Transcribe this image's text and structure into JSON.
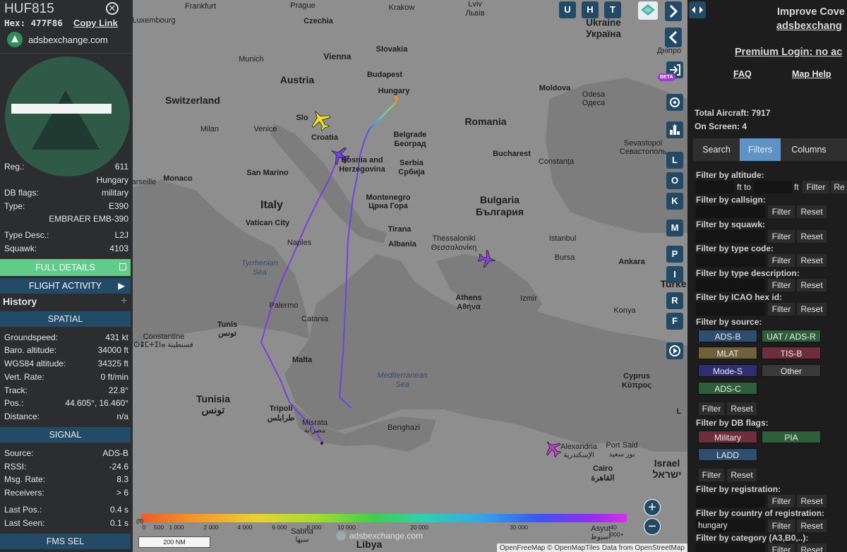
{
  "left": {
    "callsign": "HUF815",
    "hex_label": "Hex:",
    "hex": "477F86",
    "copy_link": "Copy Link",
    "brand": "adsbexchange.com",
    "fields": [
      {
        "key": "Reg.:",
        "value": "611"
      },
      {
        "key": "",
        "value": "Hungary"
      },
      {
        "key": "DB flags:",
        "value": "military"
      },
      {
        "key": "Type:",
        "value": "E390"
      },
      {
        "key": "",
        "value": "EMBRAER EMB-390"
      },
      {
        "key": "Type Desc.:",
        "value": "L2J"
      },
      {
        "key": "Squawk:",
        "value": "4103"
      }
    ],
    "full_details": "FULL DETAILS",
    "flight_activity": "FLIGHT ACTIVITY",
    "history": "History",
    "spatial_header": "SPATIAL",
    "spatial": [
      {
        "key": "Groundspeed:",
        "value": "431 kt"
      },
      {
        "key": "Baro. altitude:",
        "value": "34000 ft"
      },
      {
        "key": "WGS84 altitude:",
        "value": "34325 ft"
      },
      {
        "key": "Vert. Rate:",
        "value": "0 ft/min"
      },
      {
        "key": "Track:",
        "value": "22.8°"
      },
      {
        "key": "Pos.:",
        "value": "44.605°, 16.460°"
      },
      {
        "key": "Distance:",
        "value": "n/a"
      }
    ],
    "signal_header": "SIGNAL",
    "signal": [
      {
        "key": "Source:",
        "value": "ADS-B"
      },
      {
        "key": "RSSI:",
        "value": "-24.6"
      },
      {
        "key": "Msg. Rate:",
        "value": "8.3"
      },
      {
        "key": "Receivers:",
        "value": "> 6"
      },
      {
        "key": "Last Pos.:",
        "value": "0.4 s"
      },
      {
        "key": "Last Seen:",
        "value": "0.1 s"
      }
    ],
    "fms_header": "FMS SEL"
  },
  "map": {
    "labels": {
      "frankfurt": "Frankfurt",
      "prague": "Prague",
      "krakow": "Krakow",
      "lviv": "Lviv",
      "lviv_local": "Львів",
      "luxembourg": "Luxembourg",
      "czechia": "Czechia",
      "ukraine": "Ukraine",
      "ukraine_local": "Україна",
      "slovakia": "Slovakia",
      "munich": "Munich",
      "vienna": "Vienna",
      "dnipro": "Дніпро",
      "austria": "Austria",
      "budapest": "Budapest",
      "hungary": "Hungary",
      "moldova": "Moldova",
      "odesa": "Odesa",
      "odesa_local": "Одеса",
      "switzerland": "Switzerland",
      "milan": "Milan",
      "venice": "Venice",
      "slovenia": "Slo",
      "croatia": "Croatia",
      "belgrade": "Belgrade",
      "belgrade_local": "Београд",
      "serbia": "Serbia",
      "serbia_local": "Србија",
      "romania": "Romania",
      "bucharest": "Bucharest",
      "constanta": "Constanța",
      "sevastopol": "Sevastopol",
      "sevastopol_local": "Севастополь",
      "bosnia": "Bosnia and",
      "herzegovina": "Herzegovina",
      "monaco": "Monaco",
      "marseille": "arseille",
      "san_marino": "San Marino",
      "montenegro": "Montenegro",
      "montenegro_local": "Црна Гора",
      "bulgaria": "Bulgaria",
      "bulgaria_local": "България",
      "italy": "Italy",
      "vatican": "Vatican City",
      "tirana": "Tirana",
      "albania": "Albania",
      "thessaloniki": "Thessaloniki",
      "thessaloniki_local": "Θεσσαλονίκη",
      "istanbul": "Istanbul",
      "naples": "Naples",
      "tyrrhenian": "Tyrrhenian",
      "tyrrhenian2": "Sea",
      "bursa": "Bursa",
      "ankara": "Ankara",
      "athens": "Athens",
      "athens_local": "Αθήνα",
      "izmir": "Izmir",
      "turkey": "Turke",
      "palermo": "Palermo",
      "tunis": "Tunis",
      "tunis_local": "تونس",
      "catania": "Catania",
      "konya": "Konya",
      "constantine": "Constantine",
      "constantine_local": "ⵇⵙⴻⵎⵜⵉⵏⴰ قسنطينة",
      "malta": "Malta",
      "mediterranean": "Mediterranean",
      "mediterranean2": "Sea",
      "cyprus": "Cyprus",
      "cyprus_local": "Κύπρος",
      "tunisia": "Tunisia",
      "tunisia_local": "تونس",
      "tripoli": "Tripoli",
      "tripoli_local": "طرابلس",
      "misrata": "Misrata",
      "misrata_local": "مصراتة",
      "benghazi": "Benghazi",
      "alexandria": "Alexandria",
      "alexandria_local": "الإسكندرية",
      "port_said": "Port Said",
      "port_said_local": "بور سعيد",
      "cairo": "Cairo",
      "cairo_local": "القاهرة",
      "israel": "Israel",
      "israel_local": "ישראל",
      "sabha": "Sabha",
      "sabha_local": "سبها",
      "libya": "Libya",
      "asyut": "Asyut",
      "asyut_local": "أسيوط",
      "lebanon_frag": "L"
    },
    "top_buttons": [
      "U",
      "H",
      "T"
    ],
    "side_buttons": [
      "L",
      "O",
      "K",
      "M",
      "P",
      "I",
      "R",
      "F"
    ],
    "beta": "BETA",
    "legend_unit": "(ft)",
    "legend_ticks": [
      "0",
      "500",
      "1 000",
      "2 000",
      "4 000",
      "6 000",
      "8 000",
      "10 000",
      "20 000",
      "30 000",
      "40 000+"
    ],
    "scale": "200 NM",
    "watermark": "adsbexchange.com",
    "attribution": "OpenFreeMap © OpenMapTiles Data from OpenStreetMap",
    "zoom_in": "+",
    "zoom_out": "−"
  },
  "right": {
    "improve": "Improve Cove",
    "improve_link": "adsbexchang",
    "premium": "Premium Login: no ac",
    "faq": "FAQ",
    "map_help": "Map Help",
    "total_label": "Total Aircraft: 7917",
    "on_screen_label": "On Screen: 4",
    "tabs": [
      "Search",
      "Filters",
      "Columns"
    ],
    "filter_altitude": "Filter by altitude:",
    "ft_to": "ft to",
    "ft": "ft",
    "filter_btn": "Filter",
    "reset_btn": "Reset",
    "reset_short": "Re",
    "filter_callsign": "Filter by callsign:",
    "filter_squawk": "Filter by squawk:",
    "filter_type_code": "Filter by type code:",
    "filter_type_desc": "Filter by type description:",
    "filter_icao": "Filter by ICAO hex id:",
    "filter_source": "Filter by source:",
    "sources": [
      "ADS-B",
      "UAT / ADS-R",
      "MLAT",
      "TIS-B",
      "Mode-S",
      "Other",
      "ADS-C"
    ],
    "filter_db": "Filter by DB flags:",
    "db_flags": [
      "Military",
      "PIA",
      "LADD"
    ],
    "filter_registration": "Filter by registration:",
    "filter_country": "Filter by country of registration:",
    "country_value": "hungary",
    "filter_category": "Filter by category (A3,B0,..):"
  }
}
